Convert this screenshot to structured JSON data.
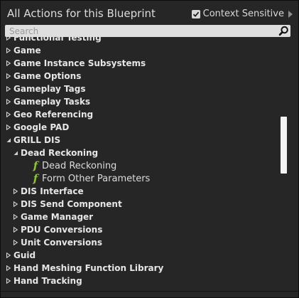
{
  "header": {
    "title": "All Actions for this Blueprint",
    "context_sensitive_label": "Context Sensitive",
    "context_sensitive_checked": true
  },
  "search": {
    "placeholder": "Search",
    "value": ""
  },
  "tree": {
    "items": [
      {
        "label": "Functional Testing",
        "kind": "category",
        "expanded": false,
        "depth": 0
      },
      {
        "label": "Game",
        "kind": "category",
        "expanded": false,
        "depth": 0
      },
      {
        "label": "Game Instance Subsystems",
        "kind": "category",
        "expanded": false,
        "depth": 0
      },
      {
        "label": "Game Options",
        "kind": "category",
        "expanded": false,
        "depth": 0
      },
      {
        "label": "Gameplay Tags",
        "kind": "category",
        "expanded": false,
        "depth": 0
      },
      {
        "label": "Gameplay Tasks",
        "kind": "category",
        "expanded": false,
        "depth": 0
      },
      {
        "label": "Geo Referencing",
        "kind": "category",
        "expanded": false,
        "depth": 0
      },
      {
        "label": "Google PAD",
        "kind": "category",
        "expanded": false,
        "depth": 0
      },
      {
        "label": "GRILL DIS",
        "kind": "category",
        "expanded": true,
        "depth": 0
      },
      {
        "label": "Dead Reckoning",
        "kind": "category",
        "expanded": true,
        "depth": 1
      },
      {
        "label": "Dead Reckoning",
        "kind": "function",
        "depth": 2
      },
      {
        "label": "Form Other Parameters",
        "kind": "function",
        "depth": 2
      },
      {
        "label": "DIS Interface",
        "kind": "category",
        "expanded": false,
        "depth": 1
      },
      {
        "label": "DIS Send Component",
        "kind": "category",
        "expanded": false,
        "depth": 1
      },
      {
        "label": "Game Manager",
        "kind": "category",
        "expanded": false,
        "depth": 1
      },
      {
        "label": "PDU Conversions",
        "kind": "category",
        "expanded": false,
        "depth": 1
      },
      {
        "label": "Unit Conversions",
        "kind": "category",
        "expanded": false,
        "depth": 1
      },
      {
        "label": "Guid",
        "kind": "category",
        "expanded": false,
        "depth": 0
      },
      {
        "label": "Hand Meshing Function Library",
        "kind": "category",
        "expanded": false,
        "depth": 0
      },
      {
        "label": "Hand Tracking",
        "kind": "category",
        "expanded": false,
        "depth": 0
      }
    ]
  },
  "icons": {
    "function": "function-f-icon",
    "search": "magnifier-icon",
    "check": "checkmark-icon"
  },
  "colors": {
    "background": "#262626",
    "text": "#e6e6e6",
    "function_icon": "#8fc13d",
    "search_field": "#dedede"
  }
}
